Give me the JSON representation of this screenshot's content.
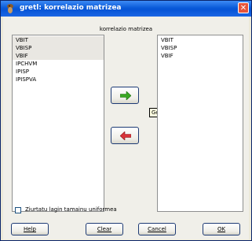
{
  "window": {
    "title": "gretl: korrelazio matrizea",
    "close_glyph": "✕"
  },
  "caption": "korrelazio matrizea",
  "left_list": {
    "items": [
      "VBIT",
      "VBISP",
      "VBIF",
      "IPCHVM",
      "IPISP",
      "IPISPVA"
    ],
    "selected": [
      0,
      1,
      2
    ]
  },
  "right_list": {
    "items": [
      "VBIT",
      "VBISP",
      "VBIF"
    ]
  },
  "arrows": {
    "add_icon": "right-arrow-green-icon",
    "remove_icon": "left-arrow-red-icon",
    "add_color": "#3aa823",
    "remove_color": "#d9343a"
  },
  "tooltip": "Gehitu",
  "checkbox": {
    "label": "Ziurtatu lagin tamainu uniformea",
    "checked": false
  },
  "buttons": {
    "help": "Help",
    "clear": "Clear",
    "cancel": "Cancel",
    "ok": "OK"
  }
}
